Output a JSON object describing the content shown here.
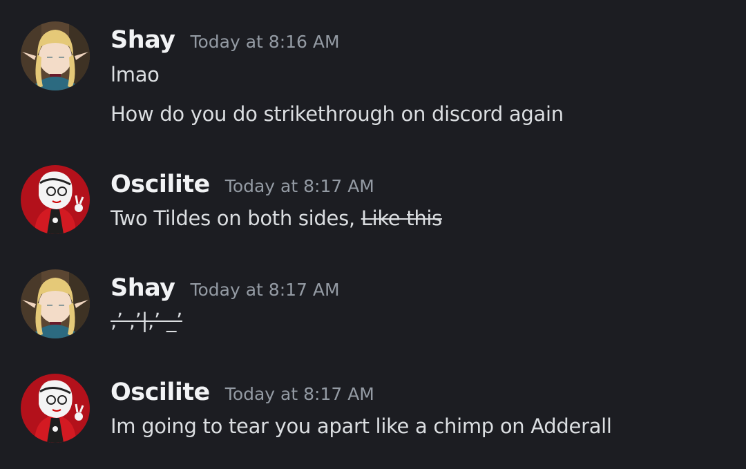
{
  "messages": [
    {
      "author": "Shay",
      "avatar_icon": "elf-girl-avatar-icon",
      "timestamp": "Today at 8:16 AM",
      "lines": [
        {
          "text": "lmao"
        },
        {
          "text": "How do you do strikethrough on discord again"
        }
      ]
    },
    {
      "author": "Oscilite",
      "avatar_icon": "red-character-avatar-icon",
      "timestamp": "Today at 8:17 AM",
      "lines": [
        {
          "text": "Two Tildes on both sides, ",
          "struck": "Like this"
        }
      ]
    },
    {
      "author": "Shay",
      "avatar_icon": "elf-girl-avatar-icon",
      "timestamp": "Today at 8:17 AM",
      "lines": [
        {
          "struck": ",’ ,’|,’ _’"
        }
      ]
    },
    {
      "author": "Oscilite",
      "avatar_icon": "red-character-avatar-icon",
      "timestamp": "Today at 8:17 AM",
      "lines": [
        {
          "text": "Im going to tear you apart like a chimp on Adderall"
        }
      ]
    }
  ],
  "colors": {
    "background": "#1c1d22",
    "username": "#f2f3f5",
    "timestamp": "#949ba4",
    "message_text": "#dbdee1",
    "oscilite_avatar_bg": "#b3111b"
  }
}
